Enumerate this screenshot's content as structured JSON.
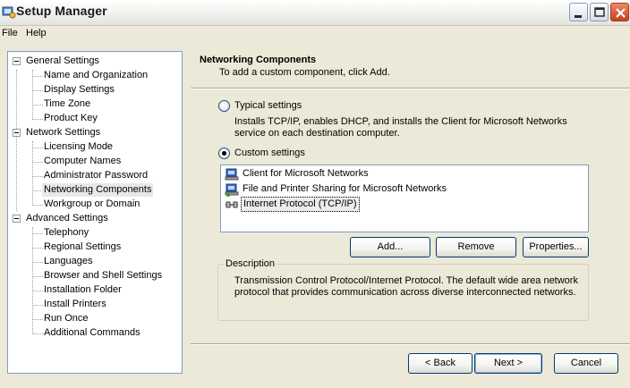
{
  "window": {
    "title": "Setup Manager"
  },
  "menu": {
    "file": "File",
    "help": "Help"
  },
  "tree": {
    "general": {
      "label": "General Settings",
      "children": [
        "Name and Organization",
        "Display Settings",
        "Time Zone",
        "Product Key"
      ]
    },
    "network": {
      "label": "Network Settings",
      "children": [
        "Licensing Mode",
        "Computer Names",
        "Administrator Password",
        "Networking Components",
        "Workgroup or Domain"
      ]
    },
    "advanced": {
      "label": "Advanced Settings",
      "children": [
        "Telephony",
        "Regional Settings",
        "Languages",
        "Browser and Shell Settings",
        "Installation Folder",
        "Install Printers",
        "Run Once",
        "Additional Commands"
      ]
    },
    "selected": "Networking Components"
  },
  "page": {
    "title": "Networking Components",
    "subtitle": "To add a custom component, click Add.",
    "typical": {
      "label": "Typical settings",
      "description_line1": "Installs TCP/IP, enables DHCP, and installs the Client for Microsoft Networks",
      "description_line2": "service on each destination computer.",
      "checked": false
    },
    "custom": {
      "label": "Custom settings",
      "checked": true
    },
    "components": [
      {
        "label": "Client for Microsoft Networks",
        "icon": "network-client-icon"
      },
      {
        "label": "File and Printer Sharing for Microsoft Networks",
        "icon": "file-printer-sharing-icon"
      },
      {
        "label": "Internet Protocol (TCP/IP)",
        "icon": "protocol-icon",
        "selected": true
      }
    ],
    "buttons": {
      "add": "Add...",
      "remove": "Remove",
      "properties": "Properties..."
    },
    "description": {
      "legend": "Description",
      "line1": "Transmission Control Protocol/Internet Protocol. The default wide area network",
      "line2": "protocol that provides communication across diverse interconnected networks."
    }
  },
  "footer": {
    "back": "< Back",
    "next": "Next >",
    "cancel": "Cancel"
  },
  "colors": {
    "window_bg": "#ece9d8",
    "border_blue": "#7f9db9",
    "close_red": "#c7401a"
  }
}
